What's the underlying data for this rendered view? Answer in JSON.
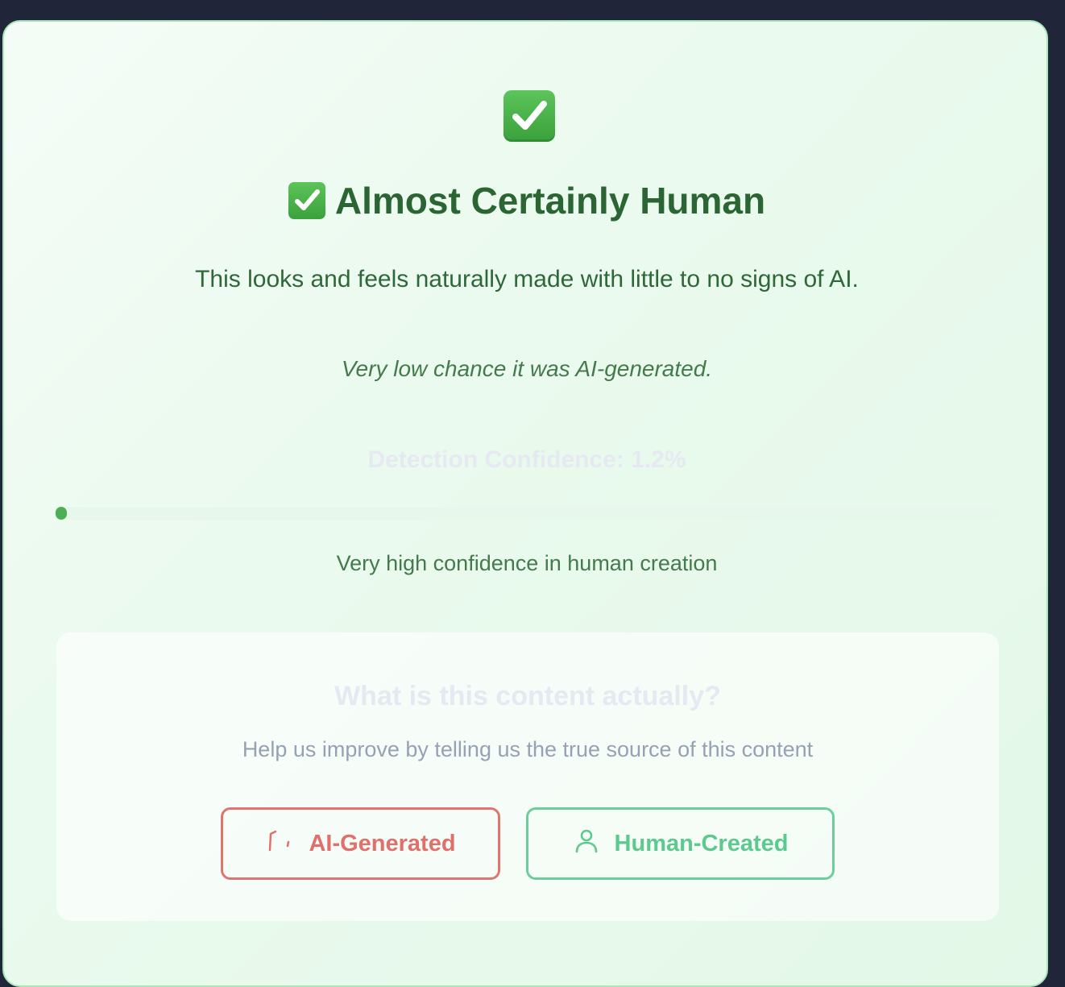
{
  "result": {
    "title": "Almost Certainly Human",
    "subtitle": "This looks and feels naturally made with little to no signs of AI.",
    "note": "Very low chance it was AI-generated.",
    "confidence_label": "Detection Confidence: 1.2%",
    "confidence_value": 1.2,
    "confidence_text": "Very high confidence in human creation"
  },
  "feedback": {
    "title": "What is this content actually?",
    "subtitle": "Help us improve by telling us the true source of this content",
    "ai_button_label": "AI-Generated",
    "human_button_label": "Human-Created"
  },
  "icons": {
    "header": "check-mark-button-icon",
    "title": "check-mark-button-icon",
    "ai_button": "robot-icon",
    "human_button": "user-icon"
  },
  "colors": {
    "accent_green": "#2c6534",
    "progress_fill": "#4caf56",
    "ai_button": "#e0706b",
    "human_button": "#5cc98f"
  }
}
